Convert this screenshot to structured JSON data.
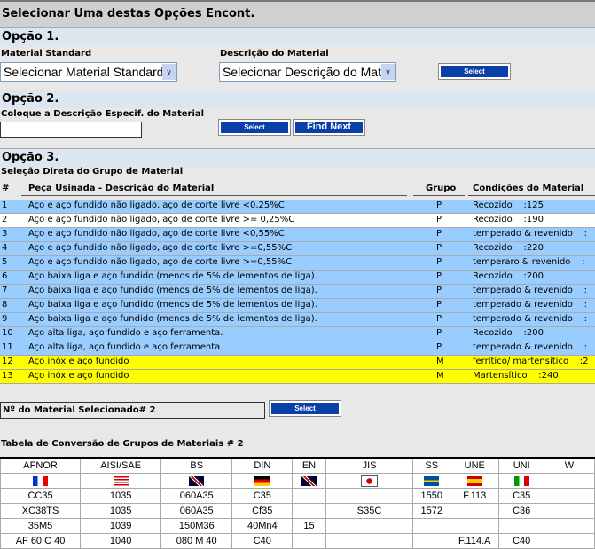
{
  "header": {
    "title": "Selecionar Uma destas Opções Encont."
  },
  "option1": {
    "heading": "Opção 1.",
    "material_standard_label": "Material Standard",
    "material_standard_value": "Selecionar Material Standard",
    "description_label": "Descrição do Material",
    "description_value": "Selecionar Descrição do Material",
    "select_label": "Select"
  },
  "option2": {
    "heading": "Opção 2.",
    "input_label": "Coloque a Descrição Especif. do Material",
    "input_value": "",
    "select_label": "Select",
    "find_next_label": "Find Next"
  },
  "option3": {
    "heading": "Opção 3.",
    "subheading": "Seleção Direta do Grupo de Material",
    "columns": {
      "num": "#",
      "desc": "Peça Usinada - Descrição do Material",
      "group": "Grupo",
      "cond": "Condições do Material"
    },
    "rows": [
      {
        "num": "1",
        "desc": "Aço e aço fundido não ligado, aço de corte livre <0,25%C",
        "group": "P",
        "cond": "Recozido    :125",
        "color": "#99ccff"
      },
      {
        "num": "2",
        "desc": "Aço e aço fundido não ligado, aço de corte livre >= 0,25%C",
        "group": "P",
        "cond": "Recozido    :190",
        "color": "#ffffff"
      },
      {
        "num": "3",
        "desc": "Aço e aço fundido não ligado, aço de corte livre <0,55%C",
        "group": "P",
        "cond": "temperado & revenido    :",
        "color": "#99ccff"
      },
      {
        "num": "4",
        "desc": "Aço e aço fundido não ligado, aço de corte livre >=0,55%C",
        "group": "P",
        "cond": "Recozido    :220",
        "color": "#99ccff"
      },
      {
        "num": "5",
        "desc": "Aço e aço fundido não ligado, aço de corte livre >=0,55%C",
        "group": "P",
        "cond": "temperaro & revenido    :",
        "color": "#99ccff"
      },
      {
        "num": "6",
        "desc": "Aço baixa liga e aço fundido (menos de 5% de lementos de liga).",
        "group": "P",
        "cond": "Recozido    :200",
        "color": "#99ccff"
      },
      {
        "num": "7",
        "desc": "Aço baixa liga e aço fundido (menos de 5% de lementos de liga).",
        "group": "P",
        "cond": "temperado & revenido    :",
        "color": "#99ccff"
      },
      {
        "num": "8",
        "desc": "Aço baixa liga e aço fundido (menos de 5% de lementos de liga).",
        "group": "P",
        "cond": "temperado & revenido    :",
        "color": "#99ccff"
      },
      {
        "num": "9",
        "desc": "Aço baixa liga e aço fundido (menos de 5% de lementos de liga).",
        "group": "P",
        "cond": "temperado & revenido    :",
        "color": "#99ccff"
      },
      {
        "num": "10",
        "desc": "Aço alta liga, aço fundido e aço ferramenta.",
        "group": "P",
        "cond": "Recozido    :200",
        "color": "#99ccff"
      },
      {
        "num": "11",
        "desc": "Aço alta liga, aço fundido e aço ferramenta.",
        "group": "P",
        "cond": "temperado & revenido    :",
        "color": "#99ccff"
      },
      {
        "num": "12",
        "desc": "Aço inóx e aço fundido",
        "group": "M",
        "cond": "ferrítico/ martensítico    :2",
        "color": "#ffff00"
      },
      {
        "num": "13",
        "desc": "Aço inóx e aço fundido",
        "group": "M",
        "cond": "Martensítico    :240",
        "color": "#ffff00"
      }
    ]
  },
  "selected": {
    "label": "Nº do Material Selecionado# 2",
    "select_label": "Select"
  },
  "conversion": {
    "title": "Tabela de Conversão de Grupos de Materiais # 2",
    "headers": [
      "AFNOR",
      "AISI/SAE",
      "BS",
      "DIN",
      "EN",
      "JIS",
      "SS",
      "UNE",
      "UNI",
      "W"
    ],
    "flags": [
      "france-flag",
      "usa-flag",
      "uk-flag",
      "germany-flag",
      "uk-flag",
      "japan-flag",
      "sweden-flag",
      "spain-flag",
      "italy-flag",
      ""
    ],
    "rows": [
      [
        "CC35",
        "1035",
        "060A35",
        "C35",
        "",
        "",
        "1550",
        "F.113",
        "C35",
        ""
      ],
      [
        "XC38TS",
        "1035",
        "060A35",
        "Cf35",
        "",
        "S35C",
        "1572",
        "",
        "C36",
        ""
      ],
      [
        "35M5",
        "1039",
        "150M36",
        "40Mn4",
        "15",
        "",
        "",
        "",
        "",
        ""
      ],
      [
        "AF 60 C 40",
        "1040",
        "080 M 40",
        "C40",
        "",
        "",
        "",
        "F.114.A",
        "C40",
        ""
      ]
    ]
  }
}
